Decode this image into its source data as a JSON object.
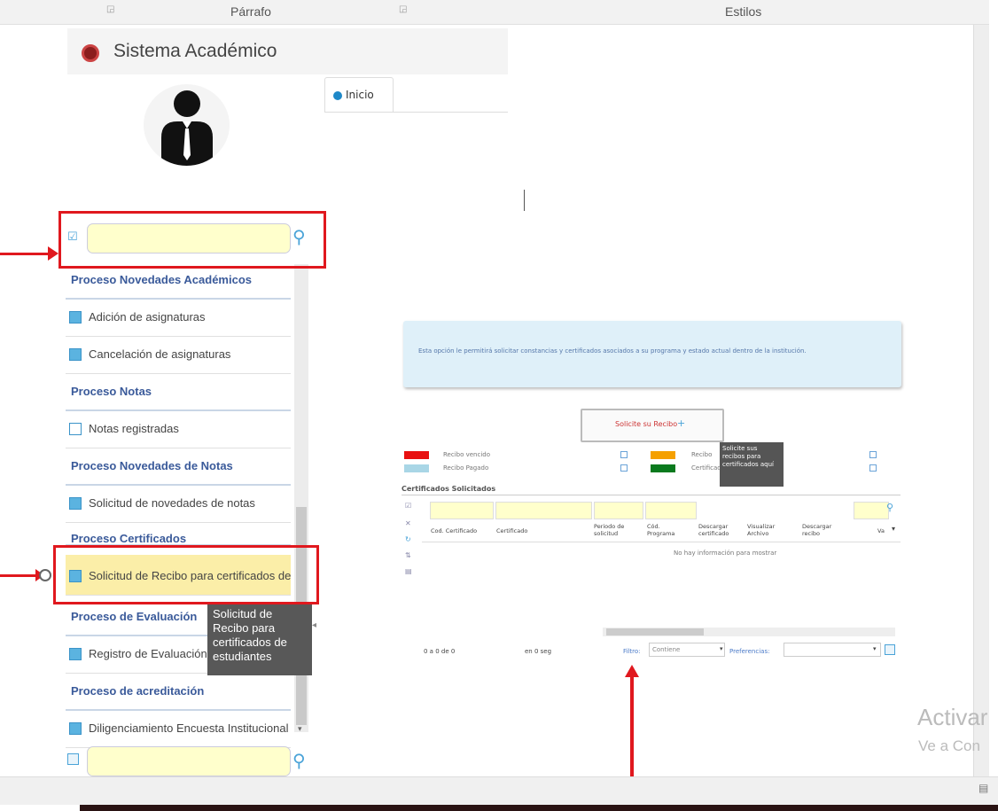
{
  "ribbon": {
    "paragraph": "Párrafo",
    "styles": "Estilos"
  },
  "app": {
    "title": "Sistema Académico"
  },
  "tabs": [
    {
      "label": "Inicio"
    }
  ],
  "sidebar": {
    "menu": [
      {
        "type": "header",
        "label": "Proceso Novedades Académicos"
      },
      {
        "type": "item",
        "label": "Adición de asignaturas"
      },
      {
        "type": "item",
        "label": "Cancelación de asignaturas"
      },
      {
        "type": "header",
        "label": "Proceso Notas"
      },
      {
        "type": "item",
        "label": "Notas registradas"
      },
      {
        "type": "header",
        "label": "Proceso Novedades de Notas"
      },
      {
        "type": "item",
        "label": "Solicitud de novedades de notas"
      },
      {
        "type": "header",
        "label": "Proceso Certificados"
      },
      {
        "type": "item",
        "label": "Solicitud de Recibo para certificados de estudiantes",
        "selected": true
      },
      {
        "type": "header",
        "label": "Proceso de Evaluación"
      },
      {
        "type": "item",
        "label": "Registro de Evaluación"
      },
      {
        "type": "header",
        "label": "Proceso de acreditación"
      },
      {
        "type": "item",
        "label": "Diligenciamiento Encuesta Institucional"
      }
    ],
    "tooltip": "Solicitud de Recibo para certificados de estudiantes"
  },
  "main": {
    "info": "Esta opción le permitirá solicitar constancias y certificados asociados a su programa y estado actual dentro de la institución.",
    "request_button": "Solicite su Recibo",
    "tooltip": "Solicite sus recibos para certificados aquí",
    "legend": [
      {
        "label": "Recibo vencido",
        "color": "#e81010"
      },
      {
        "label": "Recibo Pagado",
        "color": "#a9d6e6"
      },
      {
        "label": "Recibo",
        "color": "#f5a000"
      },
      {
        "label": "Certificado disponible",
        "color": "#0a7a1e"
      }
    ],
    "grid_title": "Certificados Solicitados",
    "columns": [
      "Cod. Certificado",
      "Certificado",
      "Periodo de solicitud",
      "Cód. Programa",
      "Descargar certificado",
      "Visualizar Archivo",
      "Descargar recibo",
      "Va"
    ],
    "no_data": "No hay información para mostrar",
    "pager": {
      "range": "0 a 0 de 0",
      "time": "en 0 seg",
      "filter_label": "Filtro:",
      "filter_value": "Contiene",
      "prefs_label": "Preferencias:"
    }
  },
  "watermark": {
    "line1": "Activar",
    "line2": "Ve a Con"
  },
  "colors": {
    "red_annotation": "#e0181e",
    "menu_header": "#3a5a9a",
    "selected_item": "#fbeea8"
  }
}
